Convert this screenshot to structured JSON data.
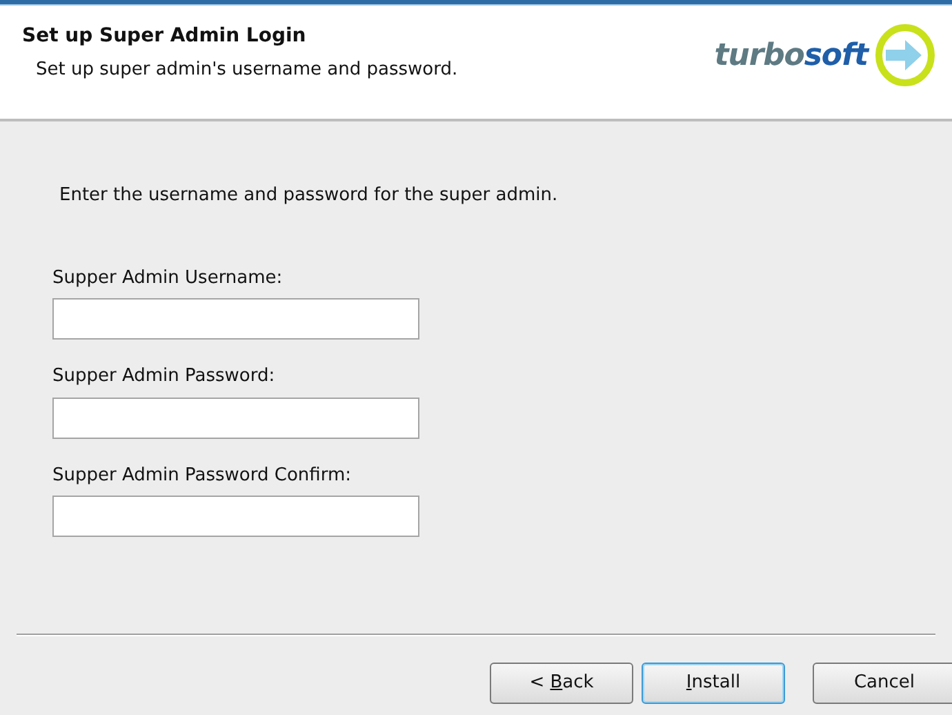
{
  "header": {
    "title": "Set up Super Admin Login",
    "subtitle": "Set up super admin's username and password.",
    "logo": {
      "part_1": "turbo",
      "part_2": "soft"
    }
  },
  "instruction": "Enter the username and password for the super admin.",
  "fields": [
    {
      "label": "Supper Admin Username:"
    },
    {
      "label": "Supper Admin Password:"
    },
    {
      "label": "Supper Admin Password Confirm:"
    }
  ],
  "buttons": [
    {
      "before": "< ",
      "access_key": "B",
      "after": "ack",
      "default": false
    },
    {
      "access_key": "I",
      "after": "nstall",
      "default": true
    },
    {
      "after": "Cancel",
      "default": false
    }
  ]
}
